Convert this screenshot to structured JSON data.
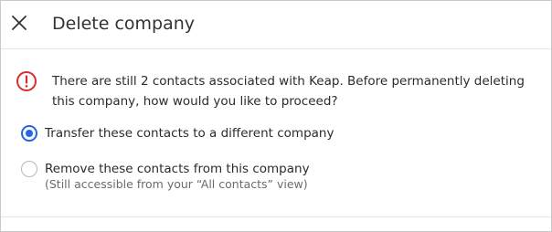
{
  "dialog": {
    "title": "Delete company",
    "close_icon": "close-icon",
    "warning_icon": "alert-circle-icon",
    "warning_color": "#d32f2f",
    "accent_color": "#2563eb",
    "message": "There are still 2 contacts associated with Keap. Before permanently deleting this company, how would you like to proceed?",
    "options": [
      {
        "label": "Transfer these contacts to a different company",
        "checked": true
      },
      {
        "label": "Remove these contacts from this company",
        "sublabel": "(Still accessible from your “All contacts” view)",
        "checked": false
      }
    ]
  }
}
